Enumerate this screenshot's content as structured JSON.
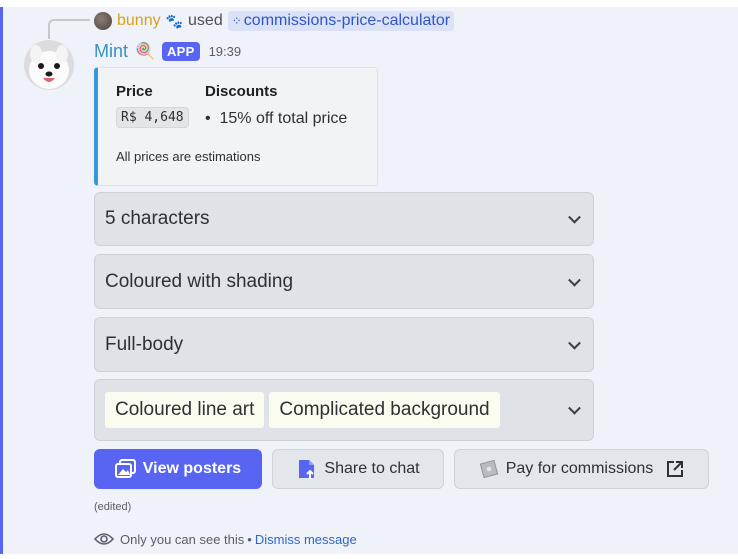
{
  "reply": {
    "user": "bunny",
    "user_emoji": "🐾",
    "used_text": "used",
    "command": "commissions-price-calculator"
  },
  "message": {
    "author": "Mint",
    "author_emoji": "🍭",
    "badge": "APP",
    "timestamp": "19:39"
  },
  "embed": {
    "price_title": "Price",
    "price_value": "R$ 4,648",
    "discounts_title": "Discounts",
    "discounts": [
      "15% off total price"
    ],
    "footer": "All prices are estimations",
    "accent_color": "#3498db"
  },
  "selects": [
    {
      "value": "5 characters"
    },
    {
      "value": "Coloured with shading"
    },
    {
      "value": "Full-body"
    }
  ],
  "multi_select": {
    "chips": [
      "Coloured line art",
      "Complicated background"
    ]
  },
  "buttons": {
    "view_posters": "View posters",
    "share_to_chat": "Share to chat",
    "pay_for_commissions": "Pay for commissions"
  },
  "edited_label": "(edited)",
  "ephemeral": {
    "note": "Only you can see this",
    "separator": "•",
    "dismiss": "Dismiss message"
  },
  "colors": {
    "brand": "#5865f2",
    "username": "#3b8fc4",
    "reply_user": "#d6a21a",
    "link": "#2f67c9"
  }
}
